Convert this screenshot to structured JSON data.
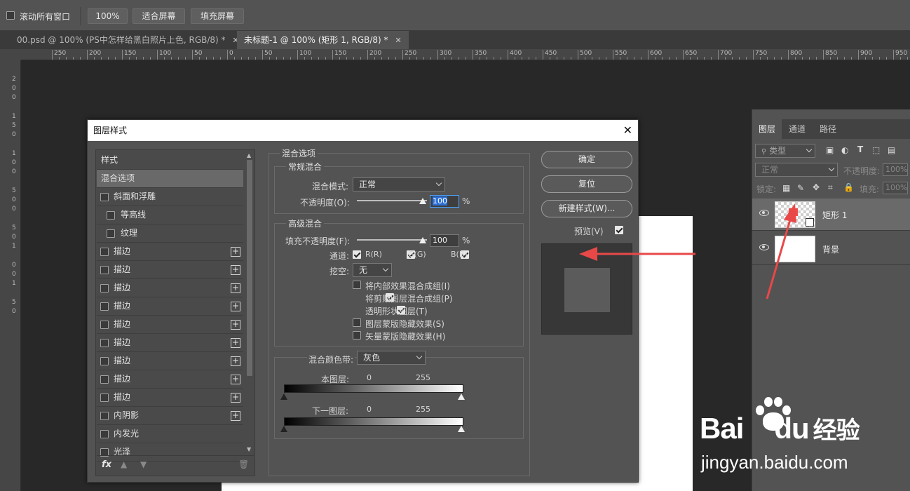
{
  "options_bar": {
    "scroll_all_label": "滚动所有窗口",
    "zoom_button": "100%",
    "fit_screen": "适合屏幕",
    "fill_screen": "填充屏幕"
  },
  "tabs": [
    {
      "label": "00.psd @ 100% (PS中怎样给黑白照片上色, RGB/8) *"
    },
    {
      "label": "未标题-1 @ 100% (矩形 1, RGB/8) *"
    }
  ],
  "ruler_numbers": [
    "250",
    "200",
    "150",
    "100",
    "50",
    "0",
    "50",
    "100",
    "150",
    "200",
    "250",
    "300",
    "350",
    "400",
    "450",
    "500",
    "550",
    "600",
    "650",
    "700",
    "750",
    "800",
    "850",
    "900",
    "950"
  ],
  "vruler_numbers": [
    "2",
    "0",
    "0",
    "1",
    "5",
    "0",
    "1",
    "0",
    "0",
    "5",
    "0",
    "0",
    "5",
    "0",
    "1",
    "0",
    "0",
    "1",
    "5",
    "0"
  ],
  "dialog": {
    "title": "图层样式",
    "close": "✕",
    "style_list": {
      "header": "样式",
      "items": [
        {
          "label": "混合选项",
          "checkbox": false,
          "plus": false,
          "selected": true
        },
        {
          "label": "斜面和浮雕",
          "checkbox": true,
          "plus": false
        },
        {
          "label": "等高线",
          "checkbox": true,
          "plus": false,
          "indent": true
        },
        {
          "label": "纹理",
          "checkbox": true,
          "plus": false,
          "indent": true
        },
        {
          "label": "描边",
          "checkbox": true,
          "plus": true
        },
        {
          "label": "描边",
          "checkbox": true,
          "plus": true
        },
        {
          "label": "描边",
          "checkbox": true,
          "plus": true
        },
        {
          "label": "描边",
          "checkbox": true,
          "plus": true
        },
        {
          "label": "描边",
          "checkbox": true,
          "plus": true
        },
        {
          "label": "描边",
          "checkbox": true,
          "plus": true
        },
        {
          "label": "描边",
          "checkbox": true,
          "plus": true
        },
        {
          "label": "描边",
          "checkbox": true,
          "plus": true
        },
        {
          "label": "描边",
          "checkbox": true,
          "plus": true
        },
        {
          "label": "内阴影",
          "checkbox": true,
          "plus": true
        },
        {
          "label": "内发光",
          "checkbox": true,
          "plus": false
        },
        {
          "label": "光泽",
          "checkbox": true,
          "plus": false
        }
      ],
      "fx_label": "fx"
    },
    "blend_options": {
      "title": "混合选项",
      "general": {
        "title": "常规混合",
        "mode_label": "混合模式:",
        "mode_value": "正常",
        "opacity_label": "不透明度(O):",
        "opacity_value": "100",
        "percent": "%"
      },
      "advanced": {
        "title": "高级混合",
        "fill_label": "填充不透明度(F):",
        "fill_value": "100",
        "percent": "%",
        "channels_label": "通道:",
        "channel_r": "R(R)",
        "channel_g": "G(G)",
        "channel_b": "B(B)",
        "knockout_label": "挖空:",
        "knockout_value": "无",
        "opt1": "将内部效果混合成组(I)",
        "opt2": "将剪贴图层混合成组(P)",
        "opt3": "透明形状图层(T)",
        "opt4": "图层蒙版隐藏效果(S)",
        "opt5": "矢量蒙版隐藏效果(H)"
      },
      "blend_if": {
        "label": "混合颜色带:",
        "value": "灰色",
        "this_layer": "本图层:",
        "this_min": "0",
        "this_max": "255",
        "under_layer": "下一图层:",
        "under_min": "0",
        "under_max": "255"
      }
    },
    "buttons": {
      "ok": "确定",
      "reset": "复位",
      "new_style": "新建样式(W)...",
      "preview": "预览(V)"
    }
  },
  "layers_panel": {
    "tabs": [
      "图层",
      "通道",
      "路径"
    ],
    "kind_filter": "类型",
    "blend_mode": "正常",
    "opacity_label": "不透明度:",
    "opacity_value": "100%",
    "lock_label": "锁定:",
    "fill_label": "填充:",
    "fill_value": "100%",
    "layers": [
      {
        "name": "矩形 1",
        "selected": true
      },
      {
        "name": "背景",
        "selected": false
      }
    ]
  },
  "watermark": {
    "brand_a": "Bai",
    "brand_b": "du",
    "brand_c": "经验",
    "url": "jingyan.baidu.com"
  },
  "colors": {
    "arrow": "#e84848",
    "shape": "#f04a4a"
  }
}
